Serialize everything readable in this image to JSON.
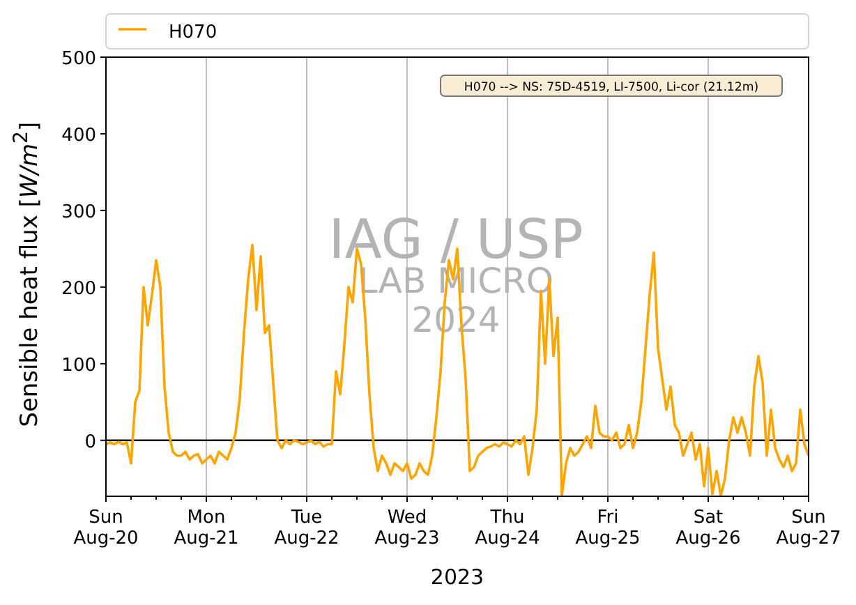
{
  "plot": {
    "annotation": "H070 --> NS: 75D-4519, LI-7500, Li-cor (21.12m)",
    "watermark": [
      "IAG / USP",
      "LAB MICRO",
      "2024"
    ],
    "chart_data": {
      "type": "line",
      "xlabel": "2023",
      "ylabel": "Sensible heat flux [*W/m*$^{2}$]",
      "ylim": [
        -73,
        500
      ],
      "yticks": [
        0,
        100,
        200,
        300,
        400,
        500
      ],
      "categories": [
        "Sun\nAug-20",
        null,
        null,
        null,
        null,
        null,
        null,
        null,
        null,
        null,
        null,
        null,
        null,
        null,
        null,
        null,
        null,
        null,
        null,
        null,
        null,
        null,
        null,
        null,
        "Mon\nAug-21",
        null,
        null,
        null,
        null,
        null,
        null,
        null,
        null,
        null,
        null,
        null,
        null,
        null,
        null,
        null,
        null,
        null,
        null,
        null,
        null,
        null,
        null,
        null,
        "Tue\nAug-22",
        null,
        null,
        null,
        null,
        null,
        null,
        null,
        null,
        null,
        null,
        null,
        null,
        null,
        null,
        null,
        null,
        null,
        null,
        null,
        null,
        null,
        null,
        null,
        "Wed\nAug-23",
        null,
        null,
        null,
        null,
        null,
        null,
        null,
        null,
        null,
        null,
        null,
        null,
        null,
        null,
        null,
        null,
        null,
        null,
        null,
        null,
        null,
        null,
        null,
        "Thu\nAug-24",
        null,
        null,
        null,
        null,
        null,
        null,
        null,
        null,
        null,
        null,
        null,
        null,
        null,
        null,
        null,
        null,
        null,
        null,
        null,
        null,
        null,
        null,
        null,
        "Fri\nAug-25",
        null,
        null,
        null,
        null,
        null,
        null,
        null,
        null,
        null,
        null,
        null,
        null,
        null,
        null,
        null,
        null,
        null,
        null,
        null,
        null,
        null,
        null,
        null,
        "Sat\nAug-26",
        null,
        null,
        null,
        null,
        null,
        null,
        null,
        null,
        null,
        null,
        null,
        null,
        null,
        null,
        null,
        null,
        null,
        null,
        null,
        null,
        null,
        null,
        null,
        "Sun\nAug-27"
      ],
      "series": [
        {
          "name": "H070",
          "color": "#ffa500",
          "values": [
            -5,
            -3,
            -5,
            -2,
            -5,
            -3,
            -30,
            50,
            65,
            200,
            150,
            190,
            235,
            200,
            70,
            10,
            -15,
            -20,
            -20,
            -15,
            -25,
            -20,
            -18,
            -30,
            -25,
            -20,
            -30,
            -15,
            -20,
            -25,
            -10,
            10,
            55,
            140,
            210,
            255,
            170,
            240,
            140,
            150,
            75,
            0,
            -10,
            0,
            -5,
            0,
            -2,
            -5,
            -3,
            0,
            -5,
            -2,
            -8,
            -5,
            -5,
            90,
            60,
            125,
            200,
            180,
            250,
            230,
            160,
            60,
            -10,
            -40,
            -20,
            -30,
            -45,
            -30,
            -35,
            -40,
            -30,
            -50,
            -45,
            -30,
            -40,
            -45,
            -20,
            30,
            90,
            180,
            235,
            210,
            250,
            150,
            80,
            -40,
            -35,
            -20,
            -15,
            -10,
            -8,
            -5,
            -8,
            -3,
            -5,
            -8,
            0,
            -5,
            5,
            -45,
            -10,
            40,
            195,
            100,
            210,
            110,
            160,
            -72,
            -30,
            -10,
            -20,
            -15,
            -5,
            5,
            -10,
            45,
            10,
            5,
            5,
            0,
            10,
            -10,
            -5,
            20,
            -10,
            10,
            50,
            120,
            190,
            245,
            120,
            80,
            40,
            70,
            20,
            10,
            -20,
            -5,
            10,
            -25,
            -5,
            -60,
            -10,
            -70,
            -40,
            -72,
            -50,
            0,
            30,
            10,
            30,
            10,
            -20,
            70,
            110,
            75,
            -20,
            40,
            -10,
            -25,
            -35,
            -20,
            -40,
            -30,
            40,
            -5,
            -20
          ]
        }
      ]
    }
  }
}
